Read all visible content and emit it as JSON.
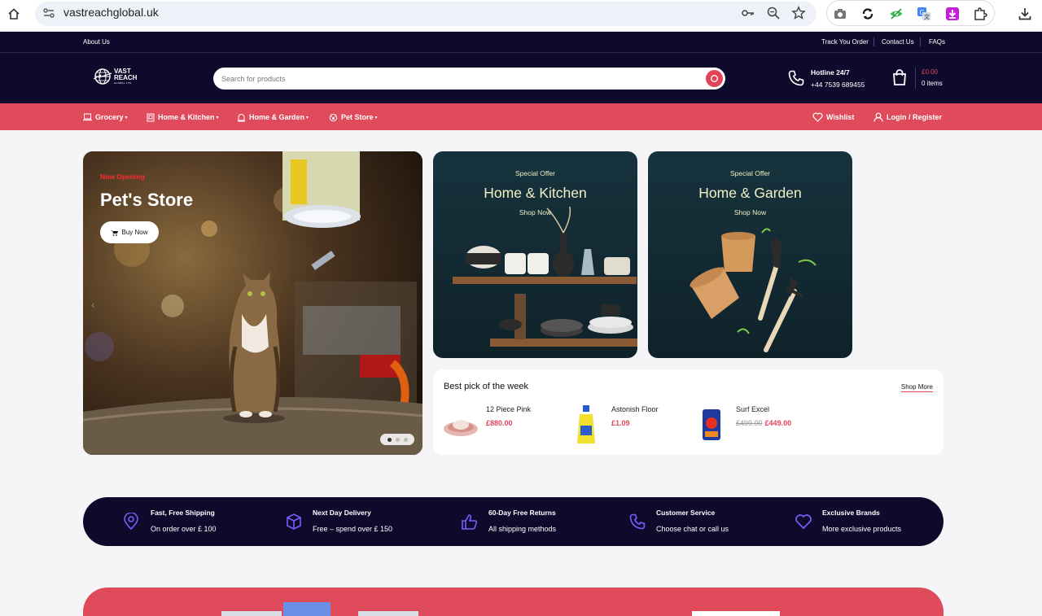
{
  "browser": {
    "url": "vastreachglobal.uk"
  },
  "topbar": {
    "about": "About Us",
    "track": "Track You Order",
    "contact": "Contact Us",
    "faqs": "FAQs"
  },
  "header": {
    "logo_line1": "VAST",
    "logo_line2": "REACH",
    "logo_line3": "GLOBAL LTD",
    "search_placeholder": "Search for products",
    "hotline_title": "Hotline 24/7",
    "hotline_number": "+44 7539 689455",
    "cart_total": "£0.00",
    "cart_items": "0 items"
  },
  "nav": {
    "items": [
      {
        "label": "Grocery",
        "icon": "laptop-icon"
      },
      {
        "label": "Home & Kitchen",
        "icon": "fridge-icon"
      },
      {
        "label": "Home & Garden",
        "icon": "garden-icon"
      },
      {
        "label": "Pet Store",
        "icon": "pet-icon"
      }
    ],
    "wishlist": "Wishlist",
    "login": "Login / Register"
  },
  "hero": {
    "tag": "Now Opening",
    "title": "Pet's Store",
    "button": "Buy Now",
    "slides": 3,
    "active_slide": 1
  },
  "promos": [
    {
      "tag": "Special Offer",
      "title": "Home & Kitchen",
      "link": "Shop Now"
    },
    {
      "tag": "Special Offer",
      "title": "Home & Garden",
      "link": "Shop Now"
    }
  ],
  "bestpick": {
    "title": "Best pick of the week",
    "more": "Shop More",
    "items": [
      {
        "name": "12 Piece Pink",
        "old_price": "",
        "price": "£880.00"
      },
      {
        "name": "Astonish Floor",
        "old_price": "",
        "price": "£1.09"
      },
      {
        "name": "Surf Excel",
        "old_price": "£499.00",
        "price": "£449.00"
      }
    ]
  },
  "features": [
    {
      "title": "Fast, Free Shipping",
      "sub": "On order over £ 100",
      "icon": "location-pin-icon"
    },
    {
      "title": "Next Day Delivery",
      "sub": "Free – spend over £ 150",
      "icon": "box-icon"
    },
    {
      "title": "60-Day Free Returns",
      "sub": "All shipping methods",
      "icon": "thumbs-up-icon"
    },
    {
      "title": "Customer Service",
      "sub": "Choose chat or call us",
      "icon": "phone-icon"
    },
    {
      "title": "Exclusive Brands",
      "sub": "More exclusive products",
      "icon": "heart-icon"
    }
  ],
  "colors": {
    "navy": "#0e0a2c",
    "accent": "#e04b5c",
    "promo_text": "#f3f1c4",
    "feature_icon": "#7b5cff"
  }
}
